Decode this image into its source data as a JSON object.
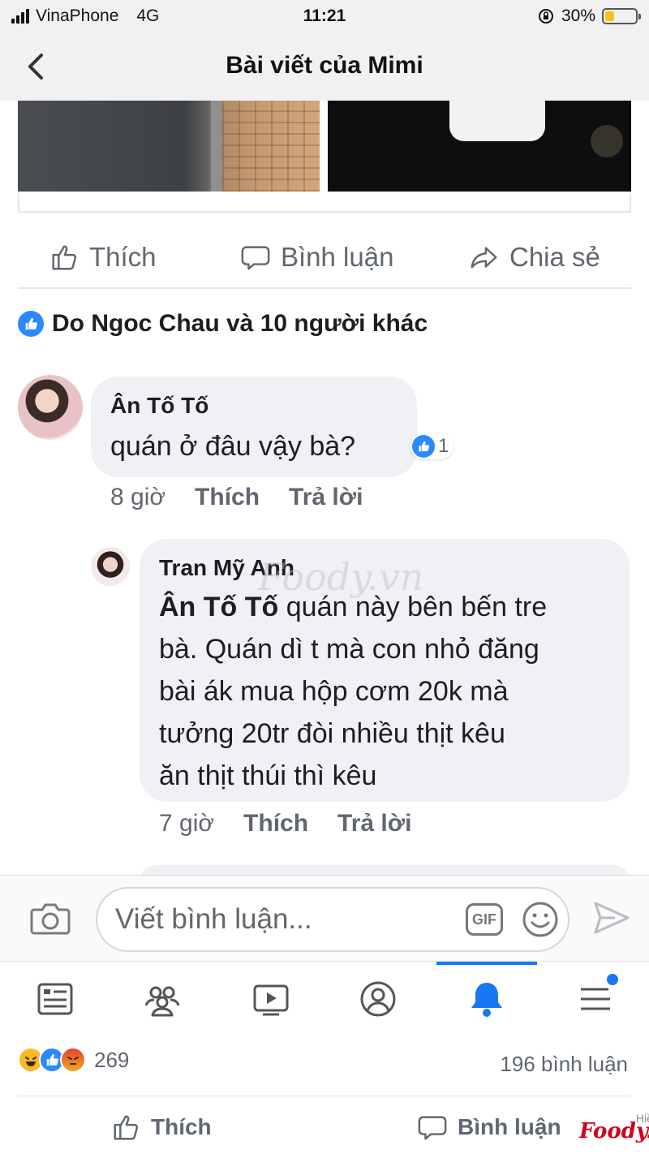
{
  "status_bar": {
    "carrier": "VinaPhone",
    "network": "4G",
    "time": "11:21",
    "battery_percent": "30%",
    "battery_level": 0.3,
    "signal_bars": 4
  },
  "header": {
    "title": "Bài viết của Mimi",
    "back_icon": "chevron-left-icon"
  },
  "post_actions": {
    "like_label": "Thích",
    "comment_label": "Bình luận",
    "share_label": "Chia sẻ"
  },
  "likes_summary": {
    "text": "Do Ngoc Chau và 10 người khác"
  },
  "comments": [
    {
      "author": "Ân Tố Tố",
      "text": "quán ở đâu vậy bà?",
      "reaction_count": "1",
      "time": "8 giờ",
      "like_label": "Thích",
      "reply_label": "Trả lời"
    },
    {
      "author": "Tran Mỹ Anh",
      "mention": "Ân Tố Tố",
      "line_1": "quán này bên bến tre",
      "line_2": "bà. Quán dì t mà con nhỏ đăng",
      "line_3": "bài ák mua hộp cơm 20k mà",
      "line_4": "tưởng 20tr đòi nhiều thịt kêu",
      "line_5": "ăn thịt thúi thì kêu",
      "time": "7 giờ",
      "like_label": "Thích",
      "reply_label": "Trả lời"
    }
  ],
  "watermark": {
    "text": "Foody.vn"
  },
  "compose": {
    "placeholder": "Viết bình luận...",
    "gif_label": "GIF"
  },
  "tabbar": {
    "items": [
      "news-feed-icon",
      "groups-icon",
      "watch-icon",
      "profile-icon",
      "notifications-icon",
      "menu-icon"
    ],
    "active": "notifications-icon"
  },
  "bottom_summary": {
    "reaction_total": "269",
    "comments_total": "196 bình luận",
    "like_label": "Thích",
    "comment_label": "Bình luận"
  },
  "credit": {
    "author": "Hiền Mai",
    "brand": "Foody.vn"
  },
  "colors": {
    "accent": "#1877f2",
    "bubble": "#f0f1f4",
    "muted_text": "#606770"
  }
}
